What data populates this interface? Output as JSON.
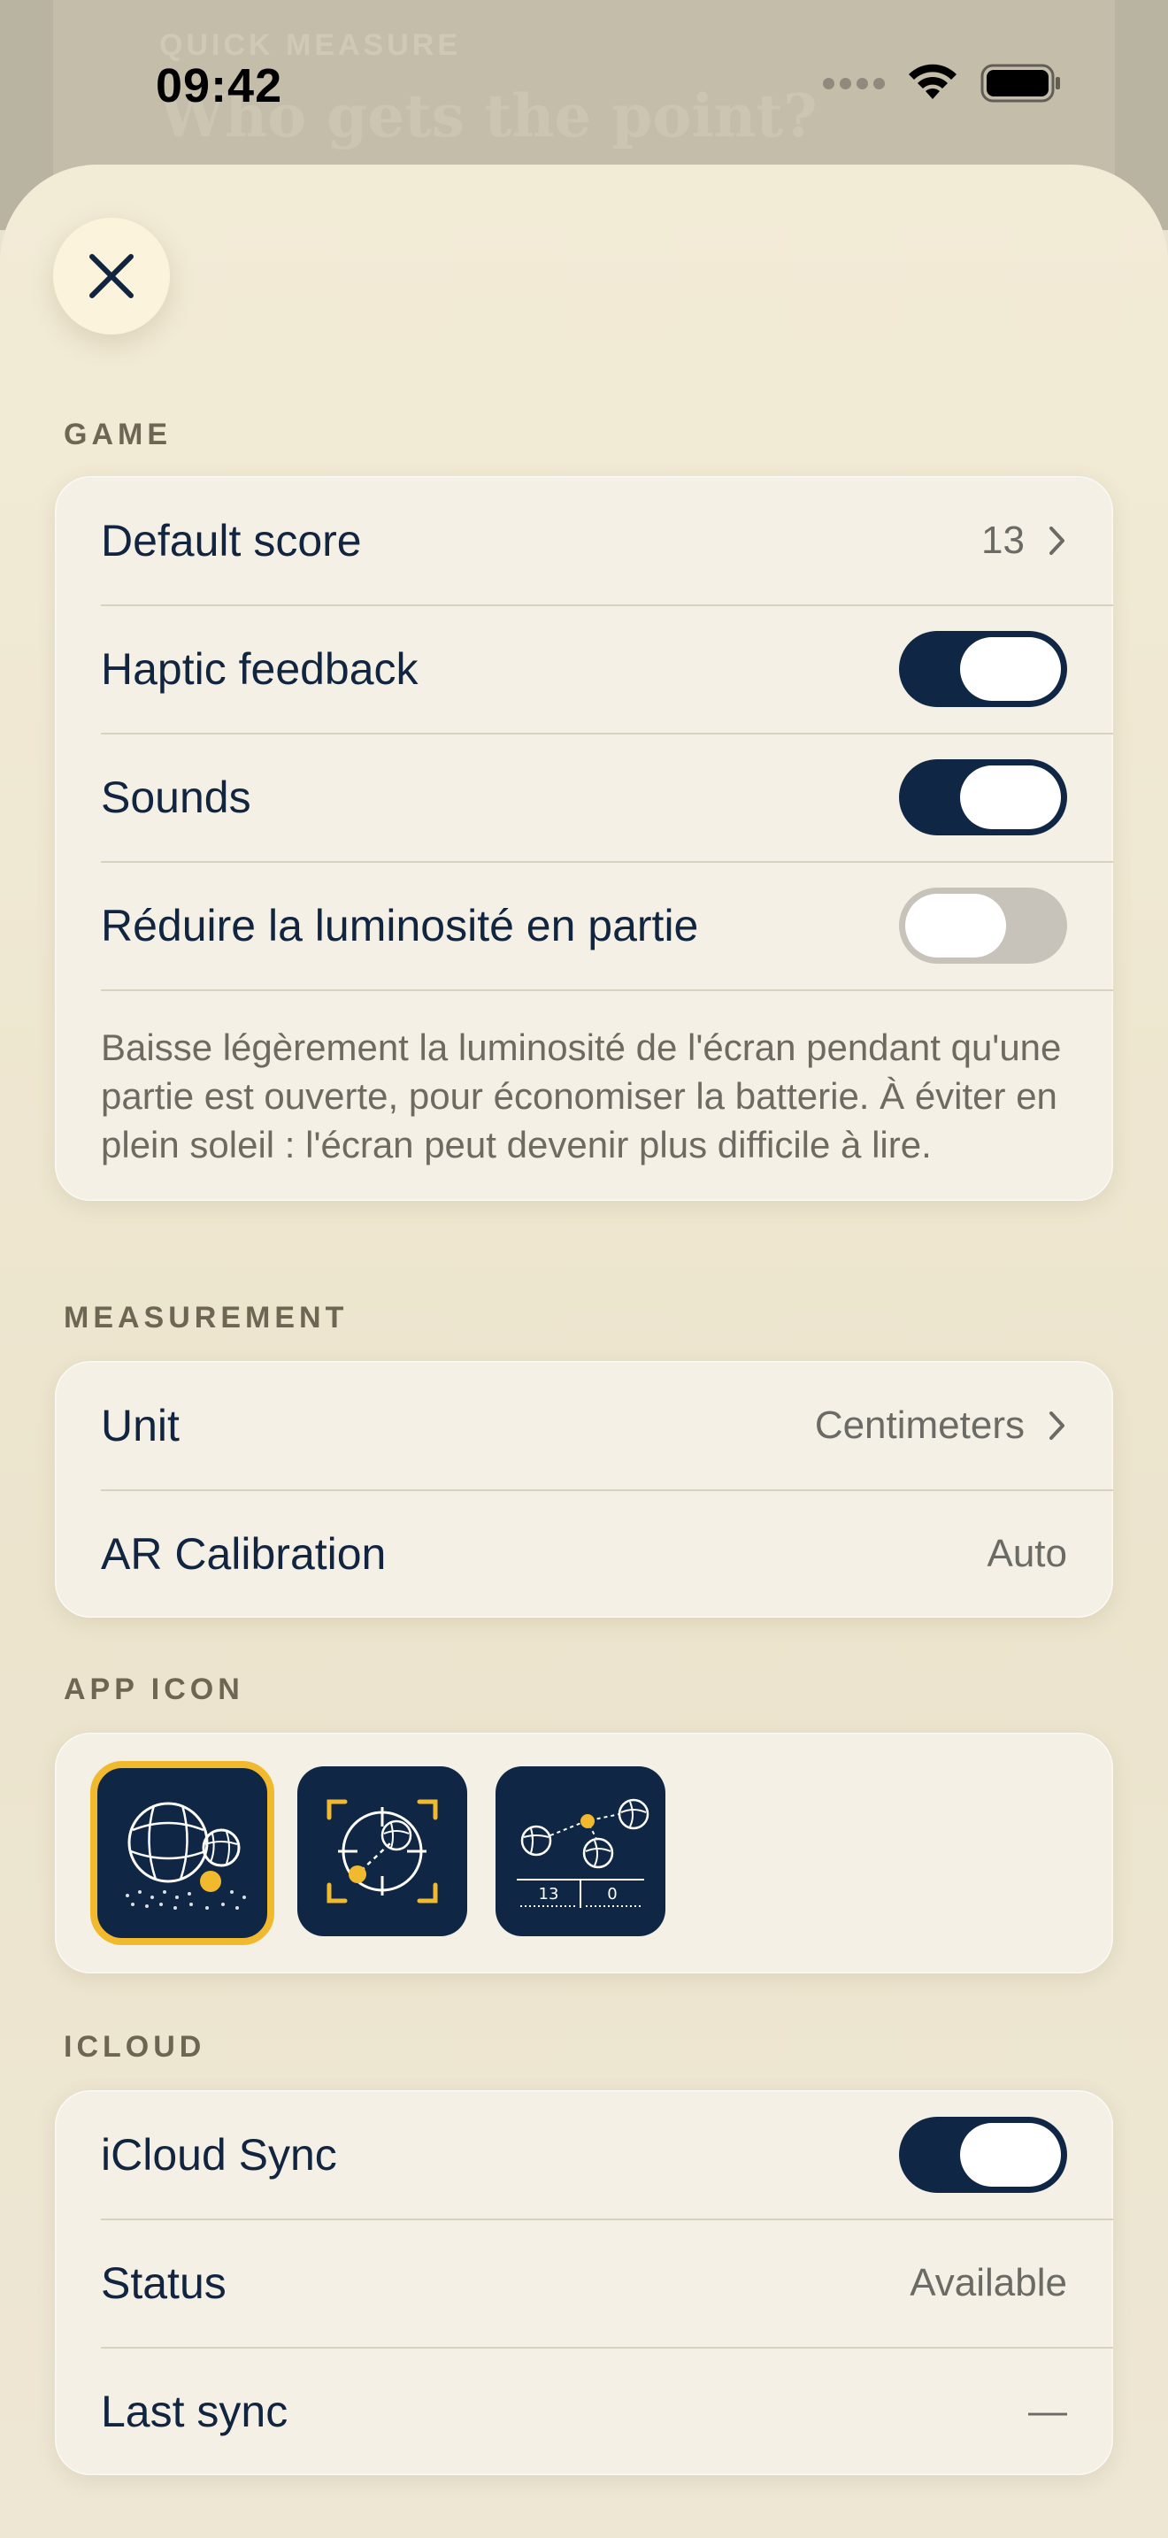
{
  "background": {
    "eyebrow": "QUICK MEASURE",
    "title": "Who gets the point?"
  },
  "status_bar": {
    "time": "09:42"
  },
  "settings": {
    "game": {
      "header": "GAME",
      "default_score_label": "Default score",
      "default_score_value": "13",
      "haptic_label": "Haptic feedback",
      "haptic_on": true,
      "sounds_label": "Sounds",
      "sounds_on": true,
      "dim_label": "Réduire la luminosité en partie",
      "dim_on": false,
      "dim_description": "Baisse légèrement la luminosité de l'écran pendant qu'une partie est ouverte, pour économiser la batterie. À éviter en plein soleil : l'écran peut devenir plus difficile à lire."
    },
    "measurement": {
      "header": "MEASUREMENT",
      "unit_label": "Unit",
      "unit_value": "Centimeters",
      "ar_label": "AR Calibration",
      "ar_value": "Auto"
    },
    "app_icon": {
      "header": "APP ICON",
      "icons": [
        {
          "name": "boules-icon",
          "selected": true
        },
        {
          "name": "target-icon",
          "selected": false
        },
        {
          "name": "scoreboard-icon",
          "selected": false,
          "score_left": "13",
          "score_right": "0"
        }
      ]
    },
    "icloud": {
      "header": "ICLOUD",
      "sync_label": "iCloud Sync",
      "sync_on": true,
      "status_label": "Status",
      "status_value": "Available",
      "last_sync_label": "Last sync",
      "last_sync_value": "—"
    }
  },
  "colors": {
    "navy": "#0f2744",
    "accent": "#f1b92e",
    "sheet": "#efe8d3"
  }
}
